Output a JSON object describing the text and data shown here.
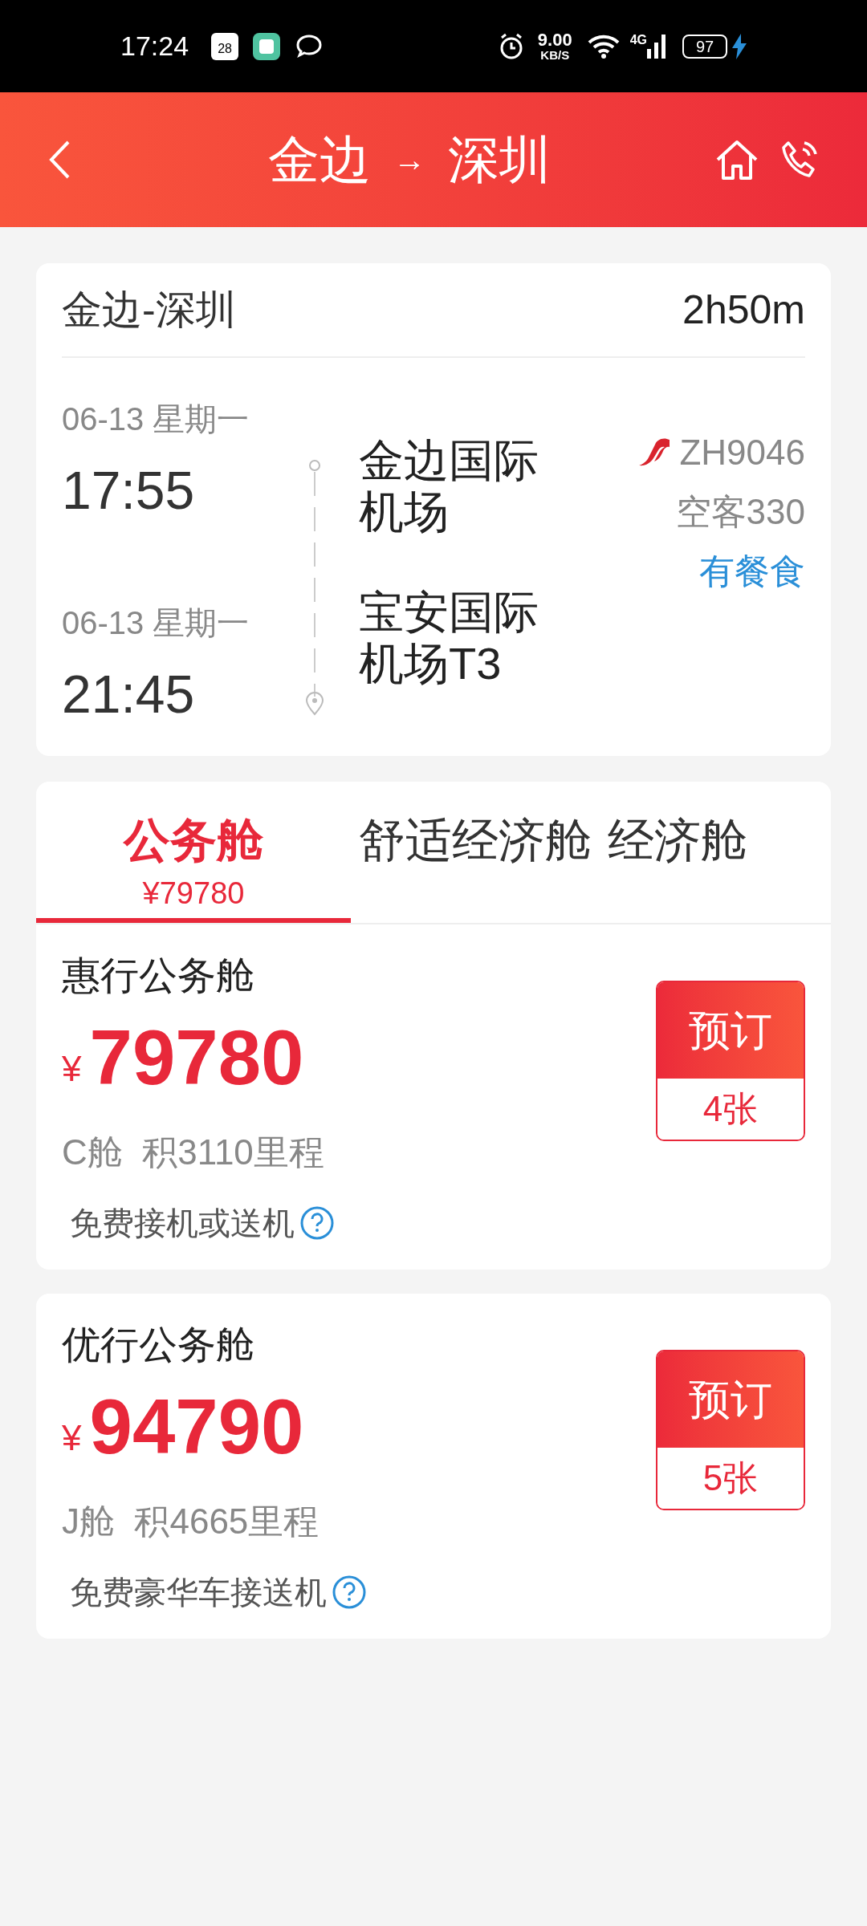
{
  "status_bar": {
    "time": "17:24",
    "calendar_day": "28",
    "net_speed": "9.00",
    "net_unit": "KB/S",
    "network": "4G",
    "battery": "97"
  },
  "header": {
    "from": "金边",
    "arrow": "→",
    "to": "深圳"
  },
  "flight": {
    "route": "金边-深圳",
    "duration": "2h50m",
    "departure": {
      "date": "06-13 星期一",
      "time": "17:55",
      "airport": "金边国际机场"
    },
    "arrival": {
      "date": "06-13 星期一",
      "time": "21:45",
      "airport": "宝安国际机场T3"
    },
    "flight_no": "ZH9046",
    "aircraft": "空客330",
    "meal": "有餐食"
  },
  "tabs": [
    {
      "label": "公务舱",
      "price": "¥79780",
      "selected": true
    },
    {
      "label": "舒适经济舱",
      "selected": false
    },
    {
      "label": "经济舱",
      "selected": false
    }
  ],
  "fares": [
    {
      "name": "惠行公务舱",
      "currency": "¥",
      "price": "79780",
      "class_info": "C舱  积3110里程",
      "note": "免费接机或送机",
      "button": "预订",
      "seats": "4张"
    },
    {
      "name": "优行公务舱",
      "currency": "¥",
      "price": "94790",
      "class_info": "J舱  积4665里程",
      "note": "免费豪华车接送机",
      "button": "预订",
      "seats": "5张"
    }
  ]
}
